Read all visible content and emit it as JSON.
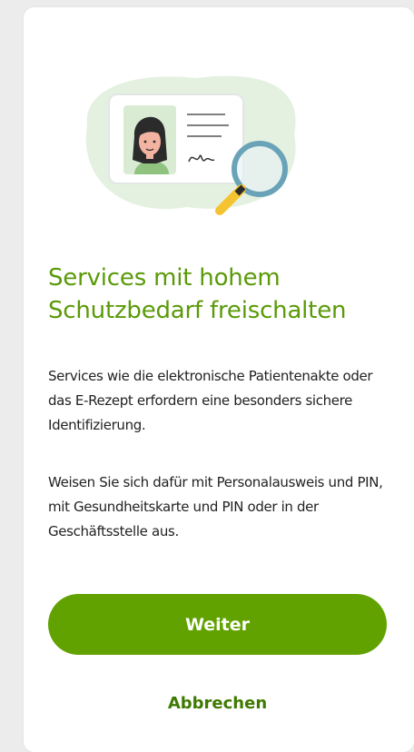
{
  "dialog": {
    "title": "Services mit hohem Schutzbedarf freischalten",
    "paragraph_1": "Services wie die elektronische Patientenakte oder das E-Rezept erfordern eine besonders sichere Identifizierung.",
    "paragraph_2": "Weisen Sie sich dafür mit Personalausweis und PIN, mit Gesundheitskarte und PIN oder in der Geschäftsstelle aus.",
    "primary_button_label": "Weiter",
    "secondary_button_label": "Abbrechen"
  },
  "illustration": {
    "icon": "id-card-magnifier-icon"
  },
  "colors": {
    "title": "#5a9a08",
    "primary_button": "#62a200",
    "secondary_text": "#3f7a00",
    "background": "#ececec",
    "card": "#ffffff"
  }
}
